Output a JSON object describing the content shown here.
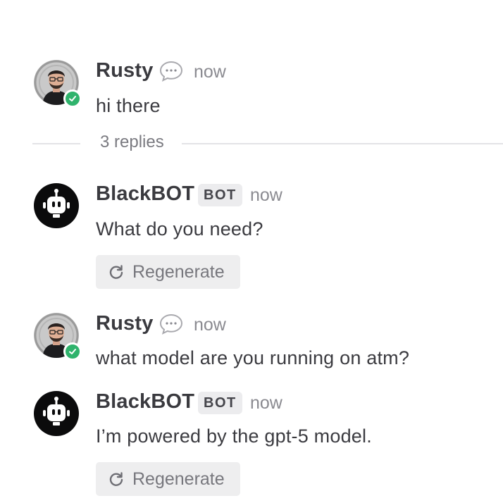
{
  "messages": [
    {
      "author": "Rusty",
      "time": "now",
      "text": "hi there",
      "type": "user",
      "status": "online"
    },
    {
      "author": "BlackBOT",
      "badge": "BOT",
      "time": "now",
      "text": "What do you need?",
      "type": "bot",
      "action_label": "Regenerate"
    },
    {
      "author": "Rusty",
      "time": "now",
      "text": "what model are you running on atm?",
      "type": "user",
      "status": "online"
    },
    {
      "author": "BlackBOT",
      "badge": "BOT",
      "time": "now",
      "text": "I’m powered by the gpt-5 model.",
      "type": "bot",
      "action_label": "Regenerate"
    }
  ],
  "thread": {
    "replies_label": "3 replies"
  },
  "icons": {
    "chat": "chat-bubble-icon",
    "regenerate": "refresh-icon",
    "status": "check-icon",
    "bot_avatar": "robot-icon"
  },
  "colors": {
    "online": "#2fb36c",
    "badge_bg": "#ececee",
    "button_bg": "#eeeeef",
    "divider": "#e3e3e6"
  }
}
